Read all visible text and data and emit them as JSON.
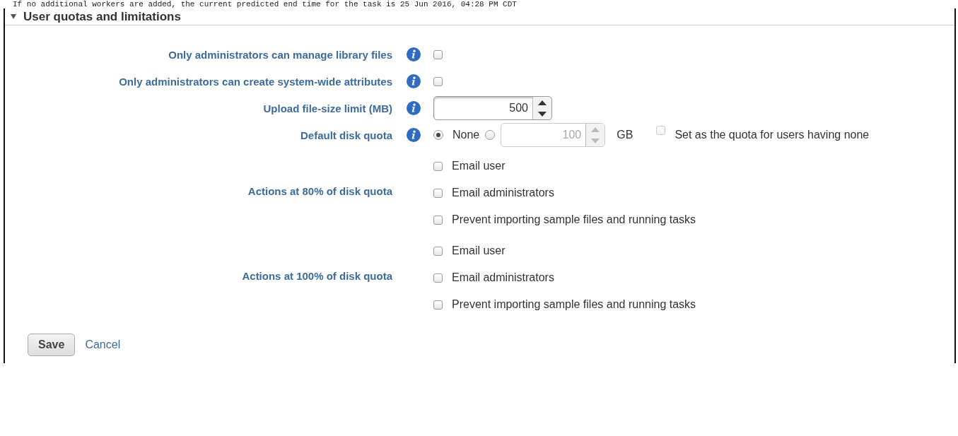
{
  "notice": "If no additional workers are added, the current predicted end time for the task is 25 Jun 2016, 04:28 PM CDT",
  "section": {
    "title": "User quotas and limitations",
    "expanded": true
  },
  "settings": [
    {
      "kind": "checkbox",
      "label": "Only administrators can manage library files",
      "checked": false
    },
    {
      "kind": "checkbox",
      "label": "Only administrators can create system-wide attributes",
      "checked": false
    },
    {
      "kind": "number",
      "label": "Upload file-size limit (MB)",
      "value": "500"
    },
    {
      "kind": "quota",
      "label": "Default disk quota",
      "options": [
        {
          "label": "None",
          "selected": true
        },
        {
          "selected": false
        }
      ],
      "value": "100",
      "unit": "GB",
      "disabled": true,
      "apply": {
        "label": "Set as the quota for users having none",
        "checked": false,
        "disabled": true
      }
    },
    {
      "kind": "actions",
      "label": "Actions at 80% of disk quota",
      "options": [
        {
          "label": "Email user",
          "checked": false
        },
        {
          "label": "Email administrators",
          "checked": false
        },
        {
          "label": "Prevent importing sample files and running tasks",
          "checked": false
        }
      ]
    },
    {
      "kind": "actions",
      "label": "Actions at 100% of disk quota",
      "options": [
        {
          "label": "Email user",
          "checked": false
        },
        {
          "label": "Email administrators",
          "checked": false
        },
        {
          "label": "Prevent importing sample files and running tasks",
          "checked": false
        }
      ]
    }
  ],
  "buttons": {
    "save": "Save",
    "cancel": "Cancel"
  }
}
